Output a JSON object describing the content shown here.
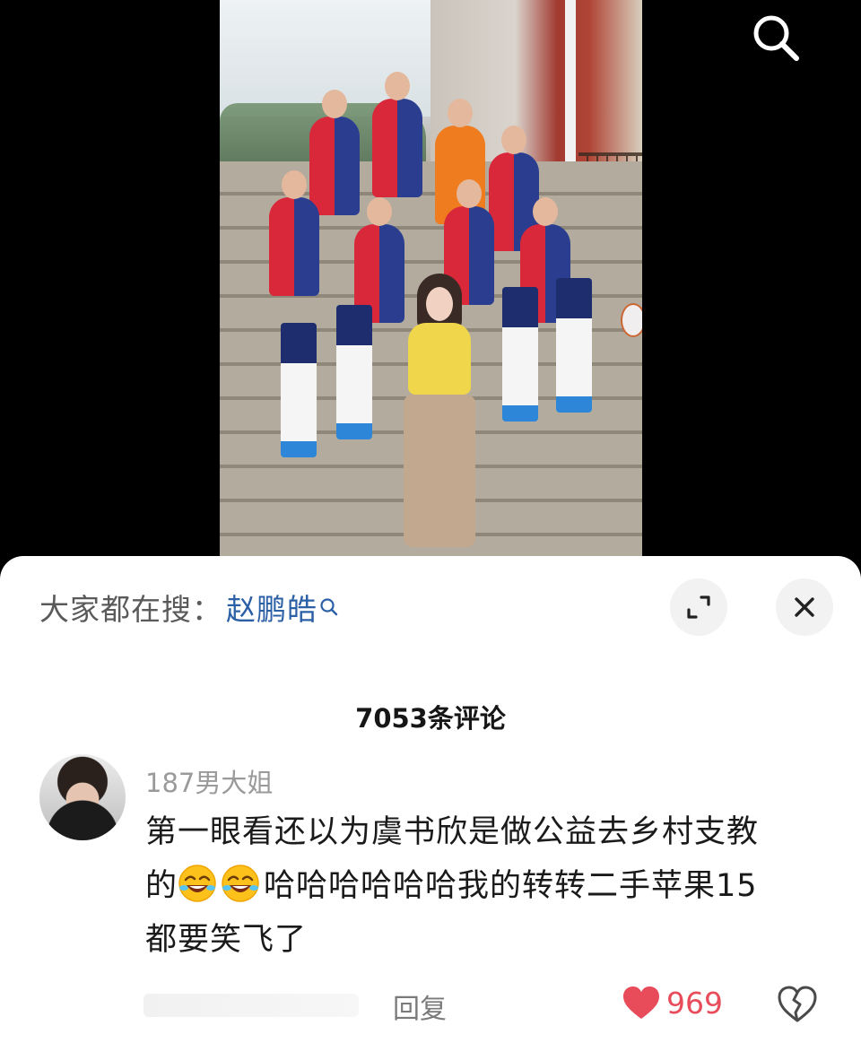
{
  "search_hint": {
    "label": "大家都在搜：",
    "term": "赵鹏皓"
  },
  "comments_header": {
    "count_text": "7053条评论"
  },
  "comment": {
    "username": "187男大姐",
    "line1": "第一眼看还以为虞书欣是做公益去乡村支教",
    "line2_prefix": "的",
    "line2_suffix": "哈哈哈哈哈哈我的转转二手苹果15",
    "line3": "都要笑飞了",
    "reply_label": "回复",
    "like_count": "969"
  },
  "colors": {
    "link": "#2b5fa6",
    "like": "#e84c5a"
  },
  "icons": {
    "search": "search-icon",
    "expand": "expand-icon",
    "close": "close-icon",
    "like": "heart-icon",
    "dislike": "broken-heart-icon",
    "emoji": "rolling-laughing-emoji"
  }
}
